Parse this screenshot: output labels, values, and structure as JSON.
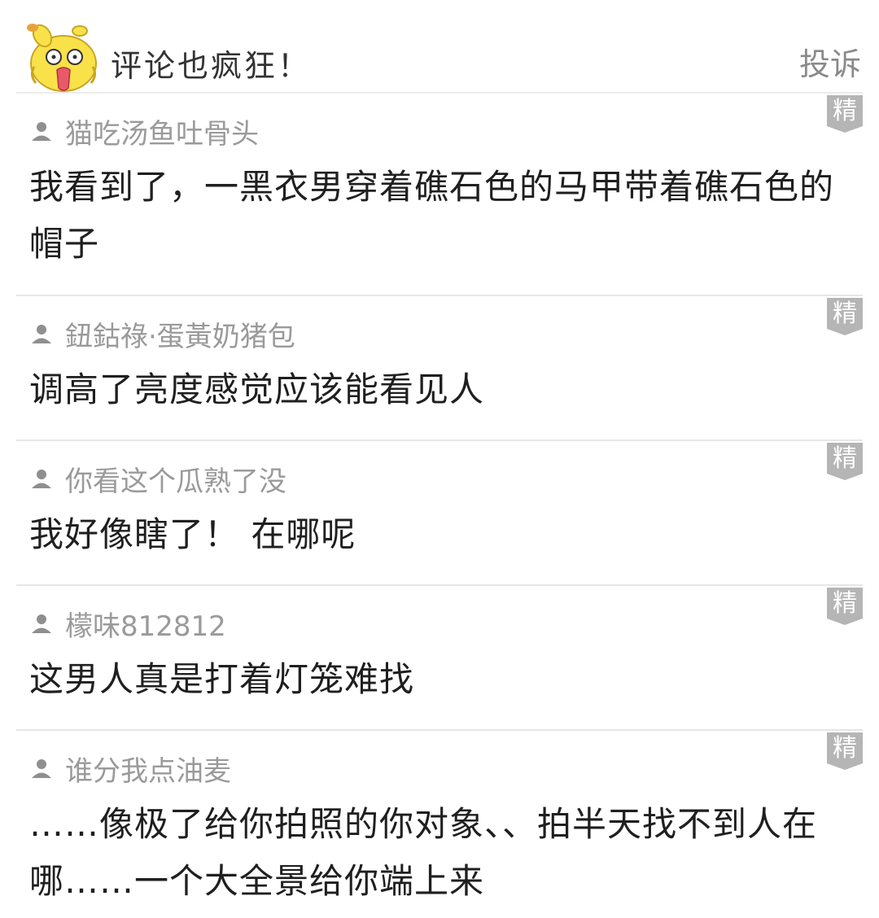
{
  "header": {
    "title": "评论也疯狂！",
    "report_label": "投诉"
  },
  "comments": [
    {
      "username": "猫吃汤鱼吐骨头",
      "text": "我看到了，一黑衣男穿着礁石色的马甲带着礁石色的帽子",
      "badge": "精"
    },
    {
      "username": "鈕鈷祿·蛋黃奶猪包",
      "text": "调高了亮度感觉应该能看见人",
      "badge": "精"
    },
    {
      "username": "你看这个瓜熟了没",
      "text": "我好像瞎了！ 在哪呢",
      "badge": "精"
    },
    {
      "username": "檬味812812",
      "text": "这男人真是打着灯笼难找",
      "badge": "精"
    },
    {
      "username": "谁分我点油麦",
      "text": "……像极了给你拍照的你对象、、拍半天找不到人在哪……一个大全景给你端上来",
      "badge": "精"
    }
  ],
  "icons": {
    "mascot": "cartoon-chick-mascot-icon",
    "user": "user-icon",
    "badge": "featured-badge-icon"
  },
  "colors": {
    "mascot_yellow": "#f9e14a",
    "badge_gray": "#b5b5b5",
    "username_gray": "#9a9a9a",
    "report_gray": "#8a8a8a",
    "divider": "#e6e6e6"
  }
}
